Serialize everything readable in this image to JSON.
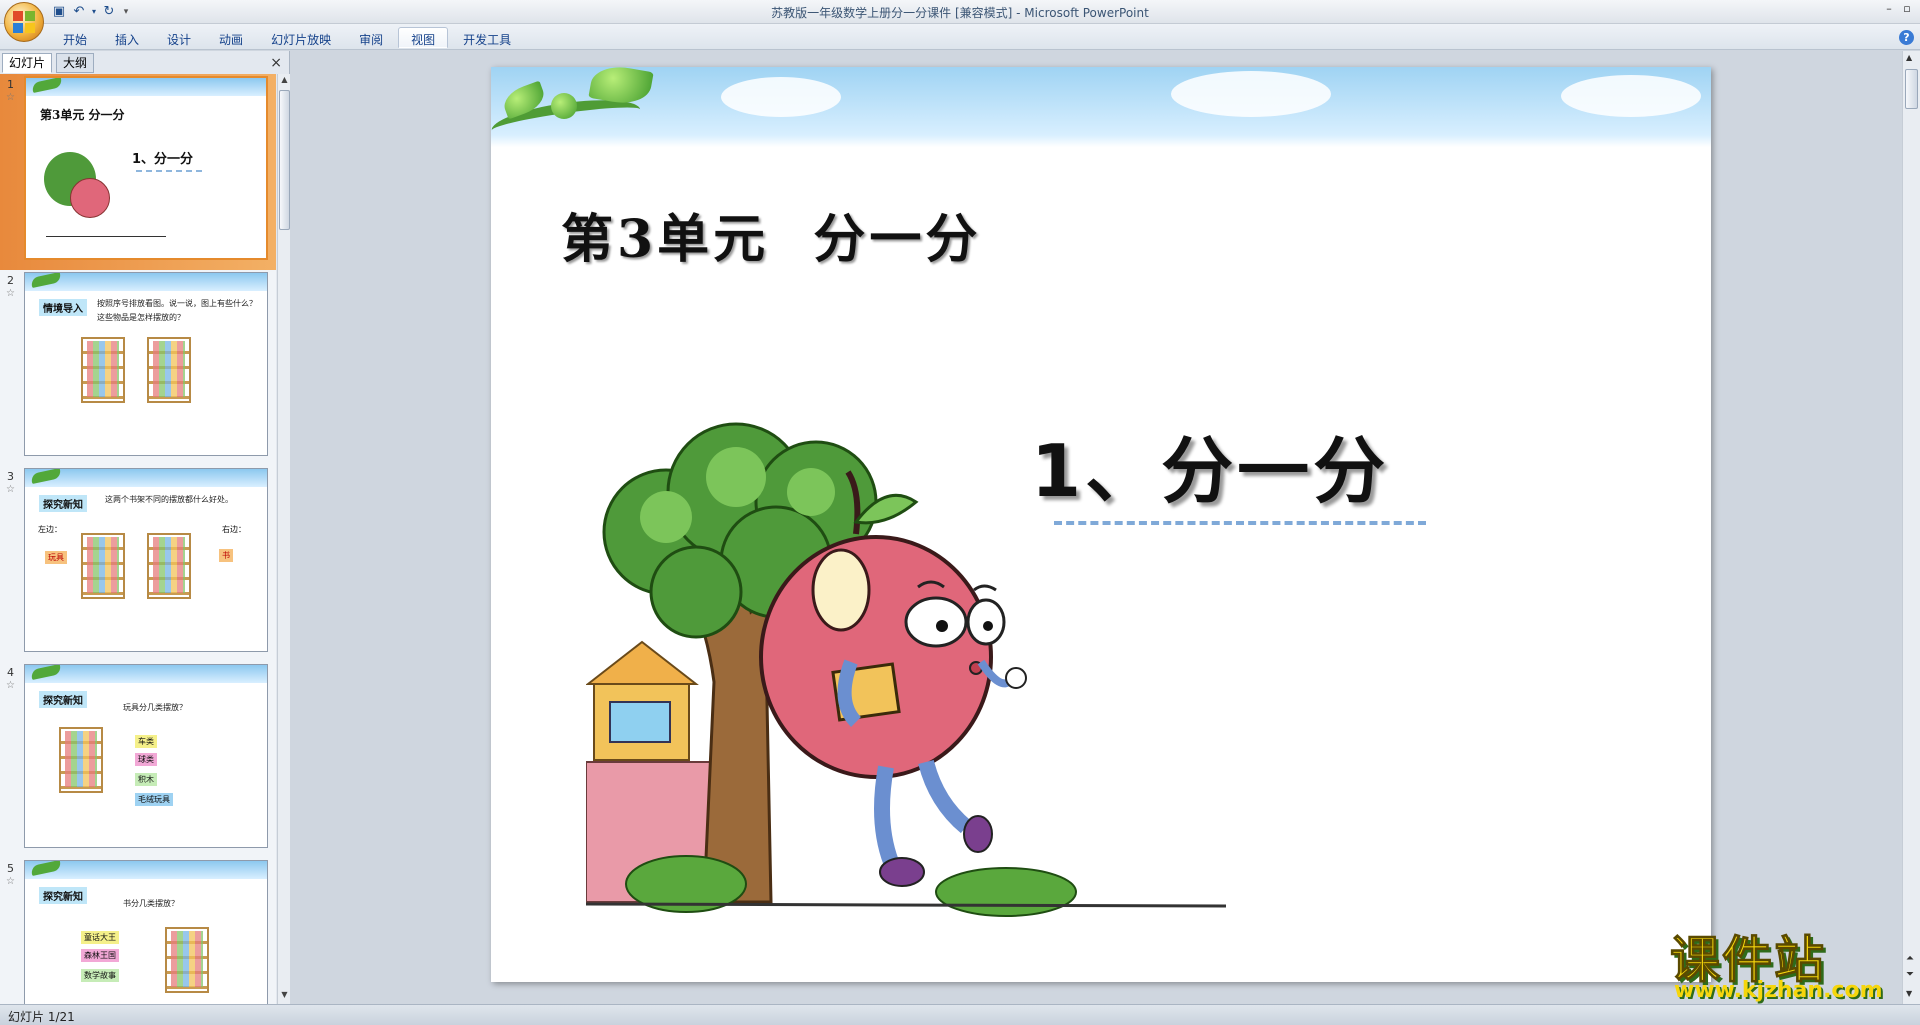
{
  "window": {
    "title": "苏教版一年级数学上册分一分课件 [兼容模式] - Microsoft PowerPoint"
  },
  "quick_access": {
    "icons": [
      "save-icon",
      "undo-icon",
      "redo-icon",
      "customize-icon"
    ]
  },
  "ribbon": {
    "tabs": [
      {
        "label": "开始"
      },
      {
        "label": "插入"
      },
      {
        "label": "设计"
      },
      {
        "label": "动画"
      },
      {
        "label": "幻灯片放映"
      },
      {
        "label": "审阅"
      },
      {
        "label": "视图",
        "active": true
      },
      {
        "label": "开发工具"
      }
    ]
  },
  "panel": {
    "tab_slides": "幻灯片",
    "tab_outline": "大纲",
    "close": "×"
  },
  "thumbnails": [
    {
      "num": "1",
      "title": "第3单元  分一分",
      "subtitle": "1、分一分"
    },
    {
      "num": "2",
      "badge": "情境导入",
      "text": "按照序号排放看图。说一说，图上有些什么？这些物品是怎样摆放的？"
    },
    {
      "num": "3",
      "badge": "探究新知",
      "text": "这两个书架不同的摆放都什么好处。",
      "left_label": "左边：",
      "right_label": "右边：",
      "left_tag": "玩具",
      "right_tag": "书"
    },
    {
      "num": "4",
      "badge": "探究新知",
      "text": "玩具分几类摆放？",
      "tags": [
        "车类",
        "球类",
        "积木",
        "毛绒玩具"
      ]
    },
    {
      "num": "5",
      "badge": "探究新知",
      "text": "书分几类摆放？",
      "tags": [
        "童话大王",
        "森林王国",
        "数学故事"
      ]
    }
  ],
  "slide": {
    "title": "第3单元  分一分",
    "subtitle": "1、分一分"
  },
  "watermark": {
    "cn": "课件站",
    "url": "www.kjzhan.com"
  },
  "status": {
    "text": "幻灯片 1/21"
  },
  "colors": {
    "accent": "#e58a2c",
    "ribbon_text": "#15428b",
    "dash": "#7fa9d8",
    "apple": "#e0677a",
    "tree": "#4f9a3a"
  }
}
